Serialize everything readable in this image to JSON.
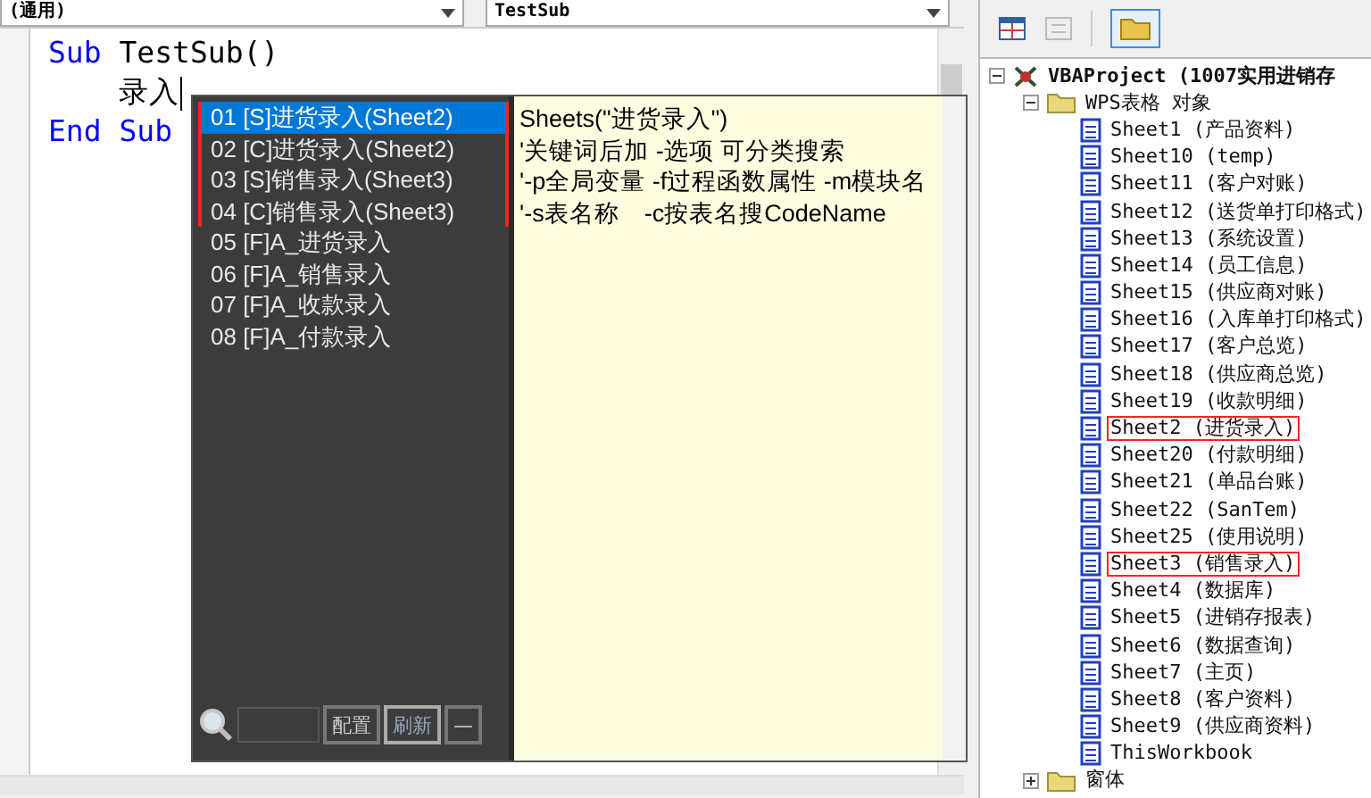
{
  "code_window": {
    "object_dropdown": "(通用)",
    "procedure_dropdown": "TestSub",
    "lines": [
      [
        {
          "kind": "keyword",
          "text": "Sub"
        },
        {
          "kind": "plain",
          "text": " TestSub()"
        }
      ],
      [
        {
          "kind": "plain",
          "text": "    录入"
        }
      ],
      [
        {
          "kind": "keyword",
          "text": "End Sub"
        }
      ]
    ]
  },
  "autocomplete": {
    "items": [
      {
        "label": "01 [S]进货录入(Sheet2)",
        "selected": true,
        "highlighted": true
      },
      {
        "label": "02 [C]进货录入(Sheet2)",
        "selected": false,
        "highlighted": true
      },
      {
        "label": "03 [S]销售录入(Sheet3)",
        "selected": false,
        "highlighted": true
      },
      {
        "label": "04 [C]销售录入(Sheet3)",
        "selected": false,
        "highlighted": true
      },
      {
        "label": "05 [F]A_进货录入",
        "selected": false,
        "highlighted": false
      },
      {
        "label": "06 [F]A_销售录入",
        "selected": false,
        "highlighted": false
      },
      {
        "label": "07 [F]A_收款录入",
        "selected": false,
        "highlighted": false
      },
      {
        "label": "08 [F]A_付款录入",
        "selected": false,
        "highlighted": false
      }
    ],
    "preview_lines": [
      "Sheets(\"进货录入\")",
      "'关键词后加 -选项 可分类搜索",
      "'-p全局变量 -f过程函数属性 -m模块名",
      "'-s表名称　-c按表名搜CodeName"
    ],
    "buttons": [
      "配置",
      "刷新",
      "—"
    ]
  },
  "project_explorer": {
    "tree": [
      {
        "label": "VBAProject (1007实用进销存",
        "kind": "project",
        "expanded": true,
        "children": [
          {
            "label": "WPS表格 对象",
            "kind": "folder",
            "expanded": true,
            "children": [
              {
                "label": "Sheet1 (产品资料)",
                "kind": "sheet",
                "highlighted": false
              },
              {
                "label": "Sheet10 (temp)",
                "kind": "sheet",
                "highlighted": false
              },
              {
                "label": "Sheet11 (客户对账)",
                "kind": "sheet",
                "highlighted": false
              },
              {
                "label": "Sheet12 (送货单打印格式)",
                "kind": "sheet",
                "highlighted": false
              },
              {
                "label": "Sheet13 (系统设置)",
                "kind": "sheet",
                "highlighted": false
              },
              {
                "label": "Sheet14 (员工信息)",
                "kind": "sheet",
                "highlighted": false
              },
              {
                "label": "Sheet15 (供应商对账)",
                "kind": "sheet",
                "highlighted": false
              },
              {
                "label": "Sheet16 (入库单打印格式)",
                "kind": "sheet",
                "highlighted": false
              },
              {
                "label": "Sheet17 (客户总览)",
                "kind": "sheet",
                "highlighted": false
              },
              {
                "label": "Sheet18 (供应商总览)",
                "kind": "sheet",
                "highlighted": false
              },
              {
                "label": "Sheet19 (收款明细)",
                "kind": "sheet",
                "highlighted": false
              },
              {
                "label": "Sheet2 (进货录入)",
                "kind": "sheet",
                "highlighted": true
              },
              {
                "label": "Sheet20 (付款明细)",
                "kind": "sheet",
                "highlighted": false
              },
              {
                "label": "Sheet21 (单品台账)",
                "kind": "sheet",
                "highlighted": false
              },
              {
                "label": "Sheet22 (SanTem)",
                "kind": "sheet",
                "highlighted": false
              },
              {
                "label": "Sheet25 (使用说明)",
                "kind": "sheet",
                "highlighted": false
              },
              {
                "label": "Sheet3 (销售录入)",
                "kind": "sheet",
                "highlighted": true
              },
              {
                "label": "Sheet4 (数据库)",
                "kind": "sheet",
                "highlighted": false
              },
              {
                "label": "Sheet5 (进销存报表)",
                "kind": "sheet",
                "highlighted": false
              },
              {
                "label": "Sheet6 (数据查询)",
                "kind": "sheet",
                "highlighted": false
              },
              {
                "label": "Sheet7 (主页)",
                "kind": "sheet",
                "highlighted": false
              },
              {
                "label": "Sheet8 (客户资料)",
                "kind": "sheet",
                "highlighted": false
              },
              {
                "label": "Sheet9 (供应商资料)",
                "kind": "sheet",
                "highlighted": false
              },
              {
                "label": "ThisWorkbook",
                "kind": "sheet",
                "highlighted": false
              }
            ]
          },
          {
            "label": "窗体",
            "kind": "folder",
            "expanded": false
          }
        ]
      }
    ]
  }
}
